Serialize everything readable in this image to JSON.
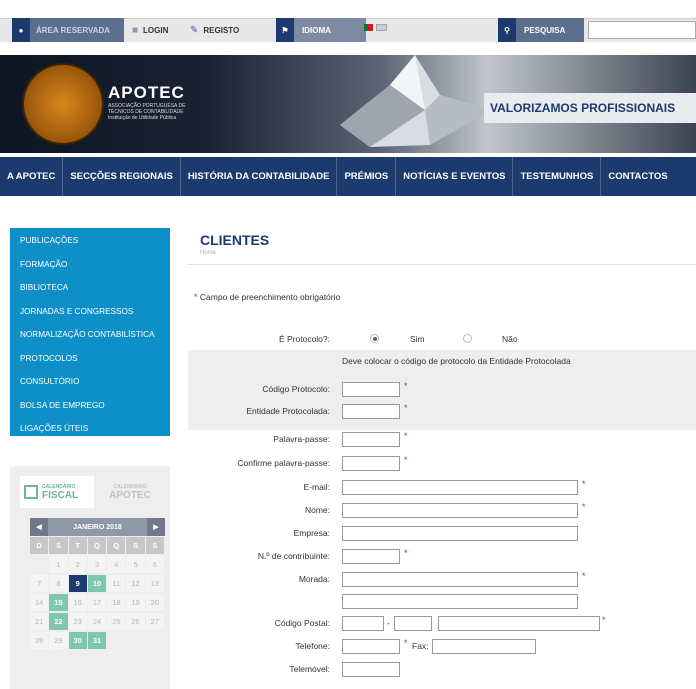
{
  "topbar": {
    "area": "ÁREA RESERVADA",
    "login": "LOGIN",
    "registo": "REGISTO",
    "idioma": "IDIOMA",
    "pesquisa": "PESQUISA"
  },
  "banner": {
    "logo_name": "APOTEC",
    "logo_sub": "ASSOCIAÇÃO PORTUGUESA DE TÉCNICOS DE CONTABILIDADE Instituição de Utilidade Pública",
    "slogan": "VALORIZAMOS PROFISSIONAIS"
  },
  "nav": [
    "A APOTEC",
    "SECÇÕES REGIONAIS",
    "HISTÓRIA DA CONTABILIDADE",
    "PRÉMIOS",
    "NOTÍCIAS E EVENTOS",
    "TESTEMUNHOS",
    "CONTACTOS"
  ],
  "sidebar": [
    "PUBLICAÇÕES",
    "FORMAÇÃO",
    "BIBLIOTECA",
    "JORNADAS E CONGRESSOS",
    "NORMALIZAÇÃO CONTABILÍSTICA",
    "PROTOCOLOS",
    "CONSULTÓRIO",
    "BOLSA DE EMPREGO",
    "LIGAÇÕES ÚTEIS"
  ],
  "calendar": {
    "tab1_small": "CALENDÁRIO",
    "tab1_big": "FISCAL",
    "tab2_small": "CALENDÁRIO",
    "tab2_big": "APOTEC",
    "month": "JANEIRO 2018",
    "days": [
      "D",
      "S",
      "T",
      "Q",
      "Q",
      "S",
      "S"
    ],
    "weeks": [
      [
        "",
        "1",
        "2",
        "3",
        "4",
        "5",
        "6"
      ],
      [
        "7",
        "8",
        "9",
        "10",
        "11",
        "12",
        "13"
      ],
      [
        "14",
        "15",
        "16",
        "17",
        "18",
        "19",
        "20"
      ],
      [
        "21",
        "22",
        "23",
        "24",
        "25",
        "26",
        "27"
      ],
      [
        "28",
        "29",
        "30",
        "31",
        "",
        "",
        ""
      ]
    ],
    "current_day": "9",
    "event_days": [
      "10",
      "15",
      "22",
      "30",
      "31"
    ]
  },
  "main": {
    "title": "CLIENTES",
    "breadcrumb": "Home",
    "required_note": "Campo de preenchimento obrigatório",
    "protocol_label": "É Protocolo?:",
    "protocol_yes": "Sim",
    "protocol_no": "Não",
    "protocol_hint": "Deve colocar o código de protocolo da Entidade Protocolada",
    "fields": {
      "codigo_protocolo": "Código Protocolo:",
      "entidade": "Entidade Protocolada:",
      "password": "Palavra-passe:",
      "confirm": "Confirme palavra-passe:",
      "email": "E-mail:",
      "nome": "Nome:",
      "empresa": "Empresa:",
      "nif": "N.º de contribuinte:",
      "morada": "Morada:",
      "codigo_postal": "Código Postal:",
      "telefone": "Telefone:",
      "fax": "Fax:",
      "telemovel": "Telemóvel:"
    }
  }
}
